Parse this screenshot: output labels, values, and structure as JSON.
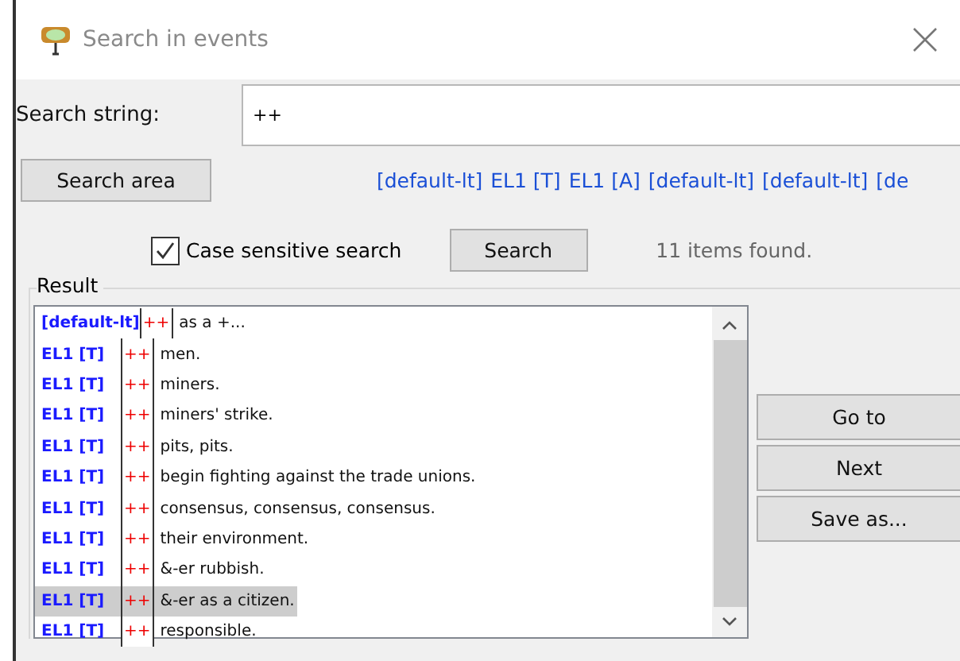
{
  "window": {
    "title": "Search in events"
  },
  "search_string": {
    "label": "Search string:",
    "value": "++"
  },
  "search_area": {
    "button": "Search area",
    "items": [
      "[default-lt]",
      "EL1 [T]",
      "EL1 [A]",
      "[default-lt]",
      "[default-lt]",
      "[de"
    ]
  },
  "case_sensitive": {
    "label": "Case sensitive search",
    "checked": true
  },
  "search_button": "Search",
  "status": "11 items found.",
  "result": {
    "title": "Result",
    "rows": [
      {
        "tag": "[default-lt]",
        "match": "++",
        "text": "as a +...",
        "selected": false
      },
      {
        "tag": "EL1 [T]",
        "match": "++",
        "text": "men.",
        "selected": false
      },
      {
        "tag": "EL1 [T]",
        "match": "++",
        "text": "miners.",
        "selected": false
      },
      {
        "tag": "EL1 [T]",
        "match": "++",
        "text": "miners' strike.",
        "selected": false
      },
      {
        "tag": "EL1 [T]",
        "match": "++",
        "text": "pits, pits.",
        "selected": false
      },
      {
        "tag": "EL1 [T]",
        "match": "++",
        "text": "begin fighting against the trade unions.",
        "selected": false
      },
      {
        "tag": "EL1 [T]",
        "match": "++",
        "text": "consensus, consensus, consensus.",
        "selected": false
      },
      {
        "tag": "EL1 [T]",
        "match": "++",
        "text": "their environment.",
        "selected": false
      },
      {
        "tag": "EL1 [T]",
        "match": "++",
        "text": "&-er rubbish.",
        "selected": false
      },
      {
        "tag": "EL1 [T]",
        "match": "++",
        "text": "&-er as a citizen.",
        "selected": true
      },
      {
        "tag": "EL1 [T]",
        "match": "++",
        "text": "responsible.",
        "selected": false
      }
    ]
  },
  "buttons": [
    "Go to",
    "Next",
    "Save as..."
  ]
}
